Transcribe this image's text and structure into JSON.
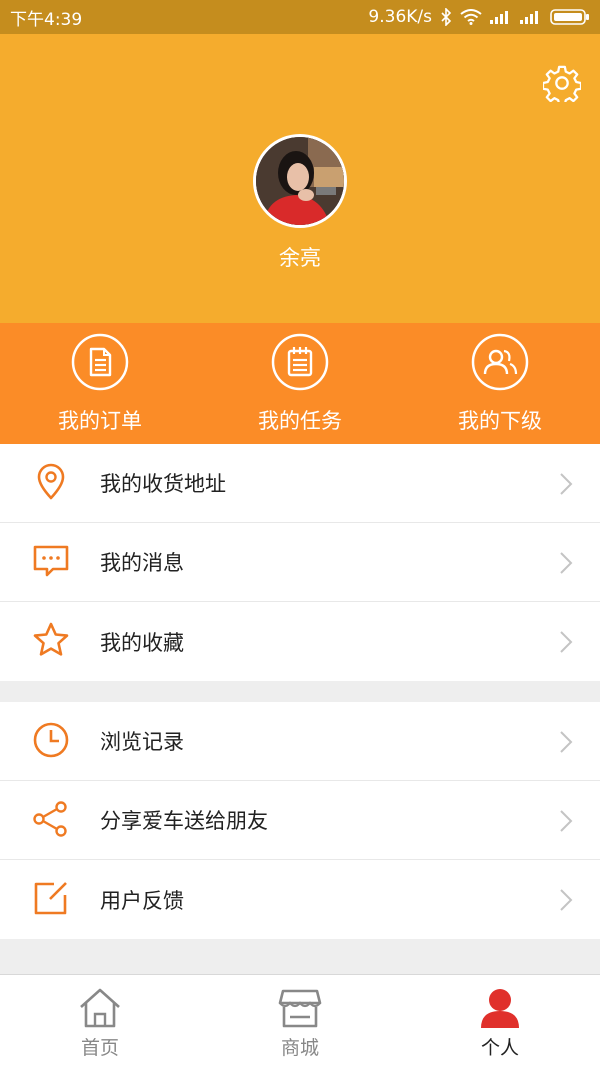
{
  "status_bar": {
    "time": "下午4:39",
    "speed": "9.36K/s"
  },
  "profile": {
    "username": "余亮"
  },
  "quick_actions": [
    {
      "label": "我的订单",
      "icon": "order-doc-icon"
    },
    {
      "label": "我的任务",
      "icon": "task-notepad-icon"
    },
    {
      "label": "我的下级",
      "icon": "team-users-icon"
    }
  ],
  "menu_group_1": [
    {
      "label": "我的收货地址",
      "icon": "location-pin-icon"
    },
    {
      "label": "我的消息",
      "icon": "message-bubble-icon"
    },
    {
      "label": "我的收藏",
      "icon": "star-icon"
    }
  ],
  "menu_group_2": [
    {
      "label": "浏览记录",
      "icon": "clock-icon"
    },
    {
      "label": "分享爱车送给朋友",
      "icon": "share-icon"
    },
    {
      "label": "用户反馈",
      "icon": "feedback-edit-icon"
    }
  ],
  "tab_bar": [
    {
      "label": "首页",
      "icon": "home-icon"
    },
    {
      "label": "商城",
      "icon": "store-icon"
    },
    {
      "label": "个人",
      "icon": "person-icon",
      "active": true
    }
  ],
  "colors": {
    "header": "#f5ac2d",
    "quick_bar": "#fb8c27",
    "icon_accent": "#ef7a22",
    "active_tab": "#e0302b"
  }
}
